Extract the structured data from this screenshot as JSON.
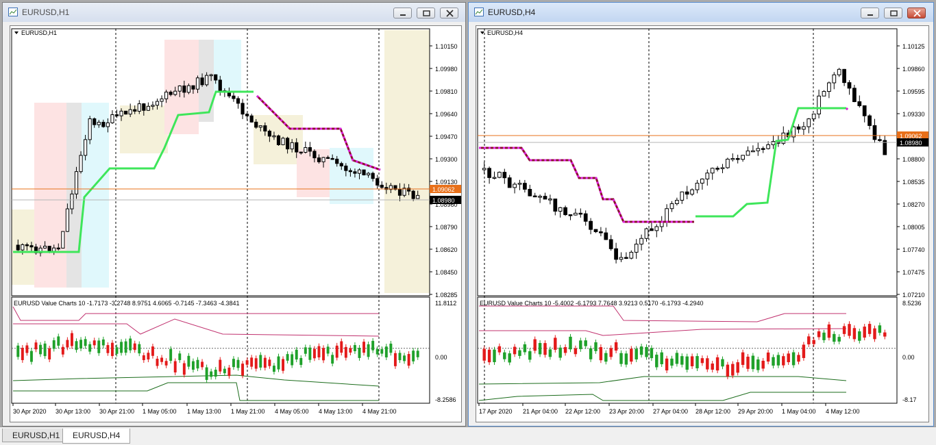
{
  "windows": {
    "h1": {
      "title": "EURUSD,H1",
      "chart_label": "EURUSD,H1",
      "indicator_label": "EURUSD Value Charts 10 -1.7173 -3.2748 8.9751 4.6065 -0.7145 -7.3463 -4.3841",
      "price_ticks": [
        "1.10150",
        "1.09980",
        "1.09810",
        "1.09640",
        "1.09470",
        "1.09300",
        "1.09130",
        "1.08960",
        "1.08790",
        "1.08620",
        "1.08450",
        "1.08285"
      ],
      "price_marker_orange": "1.09062",
      "price_marker_black": "1.08980",
      "vc_ticks": [
        "11.8112",
        "0.00",
        "-8.2586"
      ],
      "time_ticks": [
        "30 Apr 2020",
        "30 Apr 13:00",
        "30 Apr 21:00",
        "1 May 05:00",
        "1 May 13:00",
        "1 May 21:00",
        "4 May 05:00",
        "4 May 13:00",
        "4 May 21:00"
      ]
    },
    "h4": {
      "title": "EURUSD,H4",
      "chart_label": "EURUSD,H4",
      "indicator_label": "EURUSD Value Charts 10 -5.4002 -6.1793 7.7648 3.9213 0.5170 -6.1793 -4.2940",
      "price_ticks": [
        "1.10125",
        "1.09860",
        "1.09595",
        "1.09330",
        "1.09062",
        "1.08800",
        "1.08535",
        "1.08270",
        "1.08005",
        "1.07740",
        "1.07475",
        "1.07210"
      ],
      "price_marker_orange": "1.09062",
      "price_marker_black": "1.08980",
      "vc_ticks": [
        "8.5236",
        "0.00",
        "-8.17"
      ],
      "time_ticks": [
        "17 Apr 2020",
        "21 Apr 04:00",
        "22 Apr 12:00",
        "23 Apr 20:00",
        "27 Apr 04:00",
        "28 Apr 12:00",
        "29 Apr 20:00",
        "1 May 04:00",
        "4 May 12:00"
      ]
    }
  },
  "tabs": [
    {
      "label": "EURUSD,H1",
      "active": false
    },
    {
      "label": "EURUSD,H4",
      "active": true
    }
  ],
  "colors": {
    "bull_vc": "#1fa12a",
    "bear_vc": "#e31a1a",
    "trend_up": "#3ee65a",
    "trend_down": "#e020e0",
    "orange_line": "#e8701a",
    "zone_red": "#fde3e3",
    "zone_yellow": "#f5f1da",
    "zone_cyan": "#e0f8fc"
  }
}
